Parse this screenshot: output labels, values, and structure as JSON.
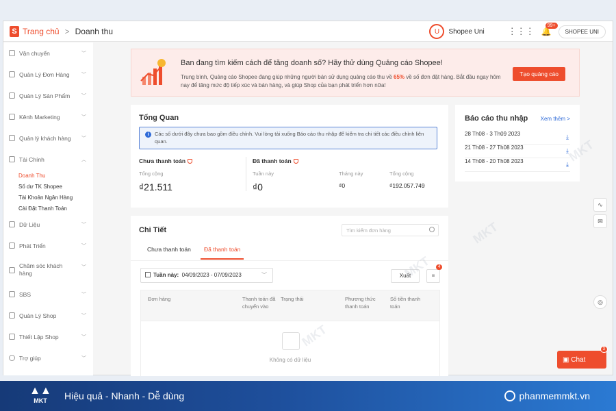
{
  "topbar": {
    "logo": "S",
    "breadcrumb_home": "Trang chủ",
    "breadcrumb_sep": ">",
    "breadcrumb_current": "Doanh thu",
    "uni_label": "Shopee Uni",
    "notification_count": "99+",
    "shop_button": "SHOPEE UNI"
  },
  "sidebar": {
    "items": [
      {
        "label": "Vận chuyển",
        "icon": "truck-icon"
      },
      {
        "label": "Quản Lý Đơn Hàng",
        "icon": "clipboard-icon"
      },
      {
        "label": "Quản Lý Sản Phẩm",
        "icon": "box-icon"
      },
      {
        "label": "Kênh Marketing",
        "icon": "tag-icon"
      },
      {
        "label": "Quản lý khách hàng",
        "icon": "users-icon"
      },
      {
        "label": "Tài Chính",
        "icon": "wallet-icon"
      }
    ],
    "finance_sub": [
      "Doanh Thu",
      "Số dư TK Shopee",
      "Tài Khoản Ngân Hàng",
      "Cài Đặt Thanh Toán"
    ],
    "items_after": [
      {
        "label": "Dữ Liệu",
        "icon": "chart-icon"
      },
      {
        "label": "Phát Triển",
        "icon": "bulb-icon"
      },
      {
        "label": "Chăm sóc khách hàng",
        "icon": "chat-icon"
      },
      {
        "label": "SBS",
        "icon": "warehouse-icon"
      },
      {
        "label": "Quản Lý Shop",
        "icon": "shop-icon"
      },
      {
        "label": "Thiết Lập Shop",
        "icon": "gear-icon"
      },
      {
        "label": "Trợ giúp",
        "icon": "help-icon"
      }
    ]
  },
  "banner": {
    "title": "Ban đang tìm kiếm cách để tăng doanh số? Hãy thử dùng Quảng cáo Shopee!",
    "text_before": "Trung bình, Quảng cáo Shopee đang giúp những người bán sử dụng quảng cáo thu về ",
    "highlight": "65%",
    "text_after": " về số đơn đặt hàng. Bắt đầu ngay hôm nay để tăng mức độ tiếp xúc và bán hàng, và giúp Shop của bạn phát triển hơn nữa!",
    "button": "Tạo quảng cáo"
  },
  "overview": {
    "title": "Tổng Quan",
    "info": "Các số dưới đây chưa bao gồm điều chỉnh. Vui lòng tải xuống Báo cáo thu nhập để kiểm tra chi tiết các điều chỉnh liên quan.",
    "unpaid": {
      "heading": "Chưa thanh toán",
      "total_label": "Tổng cộng",
      "total_value": "₫21.511"
    },
    "paid": {
      "heading": "Đã thanh toán",
      "week_label": "Tuần này",
      "week_value": "₫0",
      "month_label": "Tháng này",
      "month_value": "₫0",
      "total_label": "Tổng cộng",
      "total_value": "₫192.057.749"
    }
  },
  "report": {
    "title": "Báo cáo thu nhập",
    "more": "Xem thêm >",
    "rows": [
      "28 Th08 - 3 Th09 2023",
      "21 Th08 - 27 Th08 2023",
      "14 Th08 - 20 Th08 2023"
    ]
  },
  "detail": {
    "title": "Chi Tiết",
    "search_placeholder": "Tìm kiếm đơn hàng",
    "tabs": [
      "Chưa thanh toán",
      "Đã thanh toán"
    ],
    "date_label": "Tuần này:",
    "date_range": "04/09/2023 - 07/09/2023",
    "export": "Xuất",
    "list_badge": "4",
    "columns": [
      "Đơn hàng",
      "Thanh toán đã chuyển vào",
      "Trạng thái",
      "Phương thức thanh toán",
      "Số tiền thanh toán"
    ],
    "empty": "Không có dữ liệu"
  },
  "chat": {
    "label": "Chat",
    "badge": "3"
  },
  "footer": {
    "logo": "MKT",
    "slogan": "Hiệu quả - Nhanh - Dễ dùng",
    "site": "phanmemmkt.vn"
  },
  "watermark": "MKT",
  "colors": {
    "accent": "#ee4d2d",
    "link": "#2f6bd8",
    "footer": "#1e4f9c"
  }
}
